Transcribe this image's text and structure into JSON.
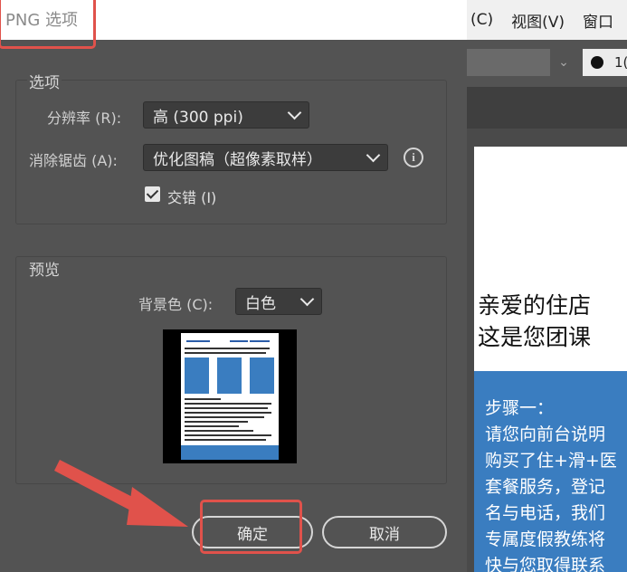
{
  "background_app": {
    "menu": [
      "(C)",
      "视图(V)",
      "窗口"
    ],
    "stroke_value": "1(",
    "artboard": {
      "heading_lines": [
        "亲爱的住店",
        "这是您团课"
      ],
      "blue_lines": [
        "步骤一：",
        "请您向前台说明",
        "购买了住+滑+医",
        "套餐服务，登记",
        "名与电话，我们",
        "专属度假教练将",
        "快与您取得联系"
      ]
    }
  },
  "dialog": {
    "title": "PNG 选项",
    "options_group": {
      "label": "选项",
      "resolution_label": "分辨率 (R):",
      "resolution_value": "高 (300 ppi)",
      "antialias_label": "消除锯齿 (A):",
      "antialias_value": "优化图稿（超像素取样）",
      "interlace_label": "交错 (I)",
      "interlace_checked": true
    },
    "preview_group": {
      "label": "预览",
      "bgcolor_label": "背景色 (C):",
      "bgcolor_value": "白色"
    },
    "ok_label": "确定",
    "cancel_label": "取消"
  },
  "colors": {
    "dialog_bg": "#535353",
    "highlight": "#e0524b",
    "art_blue": "#3a7dc0"
  },
  "icons": [
    "info-icon",
    "chevron-down-icon",
    "checkmark-icon",
    "arrow-annotation-icon"
  ]
}
